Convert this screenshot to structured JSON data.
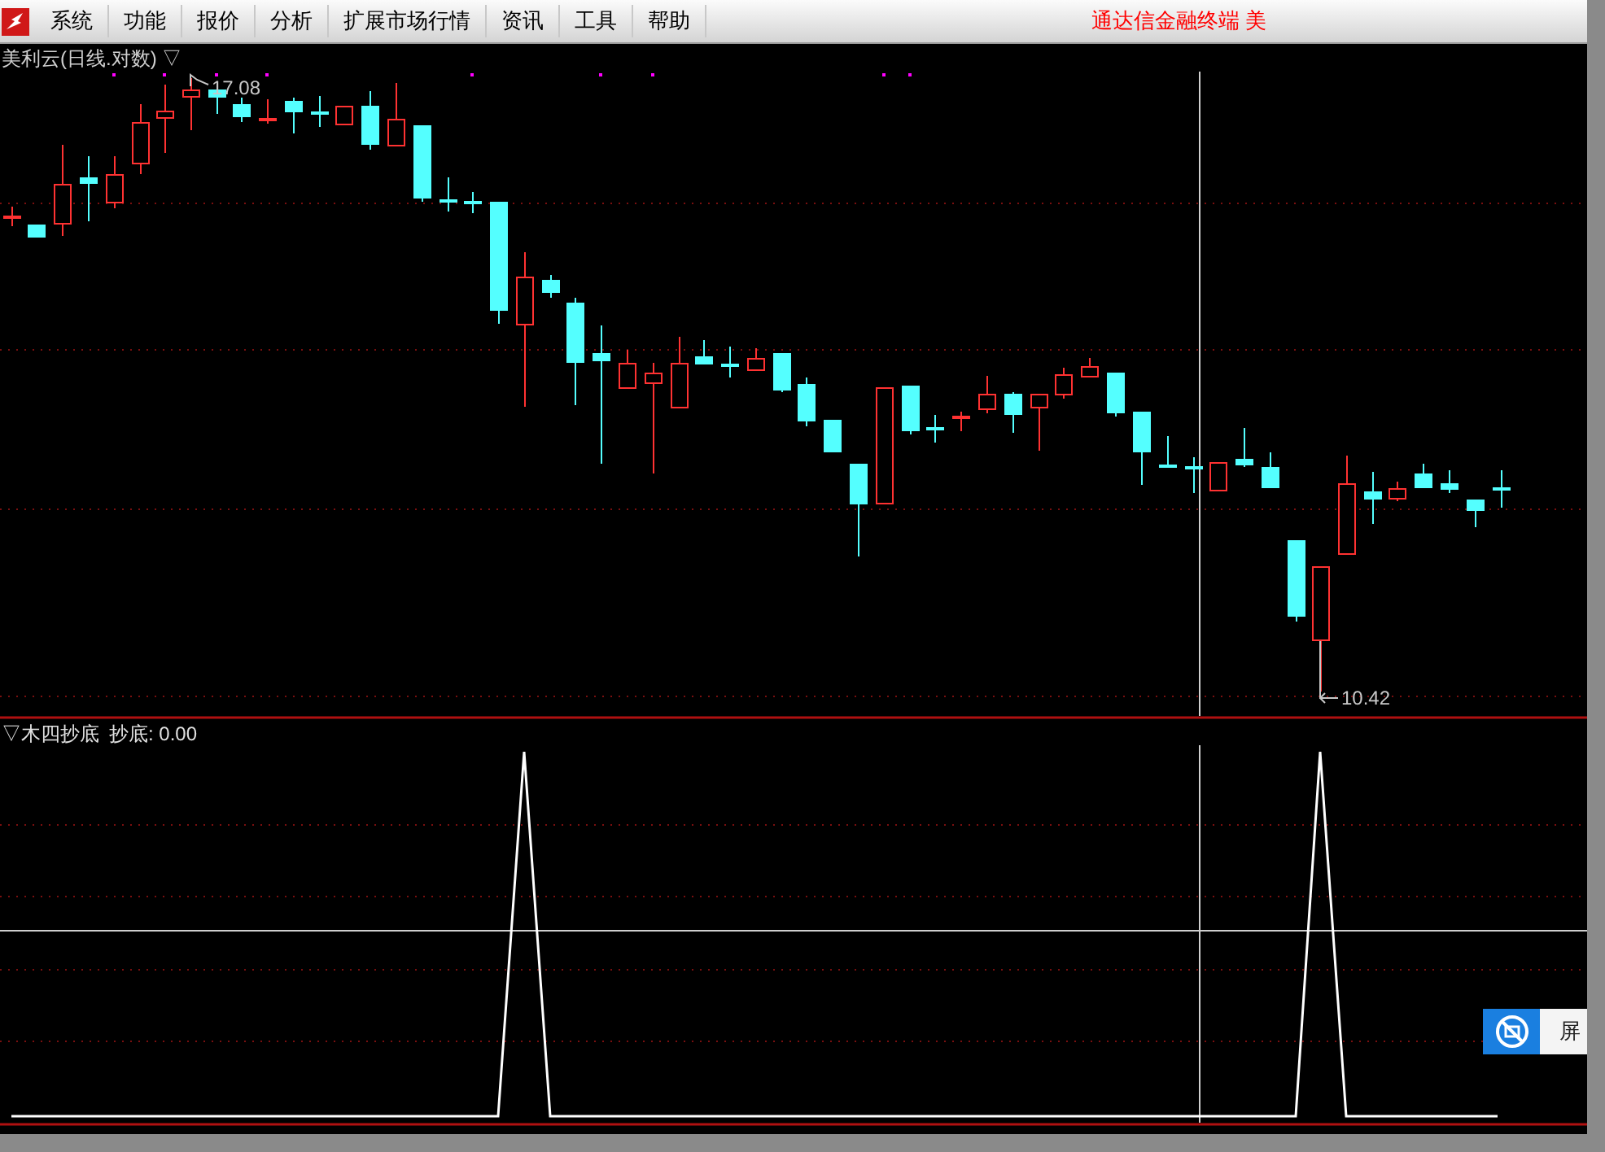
{
  "menu": {
    "items": [
      {
        "label": "系统"
      },
      {
        "label": "功能"
      },
      {
        "label": "报价"
      },
      {
        "label": "分析"
      },
      {
        "label": "扩展市场行情"
      },
      {
        "label": "资讯"
      },
      {
        "label": "工具"
      },
      {
        "label": "帮助"
      }
    ],
    "title_text": "通达信金融终端 美"
  },
  "main_panel": {
    "title": "美利云(日线.对数) ▽",
    "high_label": "17.08",
    "low_label": "10.42"
  },
  "indicator_panel": {
    "title": "▽木四抄底",
    "reading": "抄底: 0.00"
  },
  "float_button": {
    "label": "屏"
  }
}
